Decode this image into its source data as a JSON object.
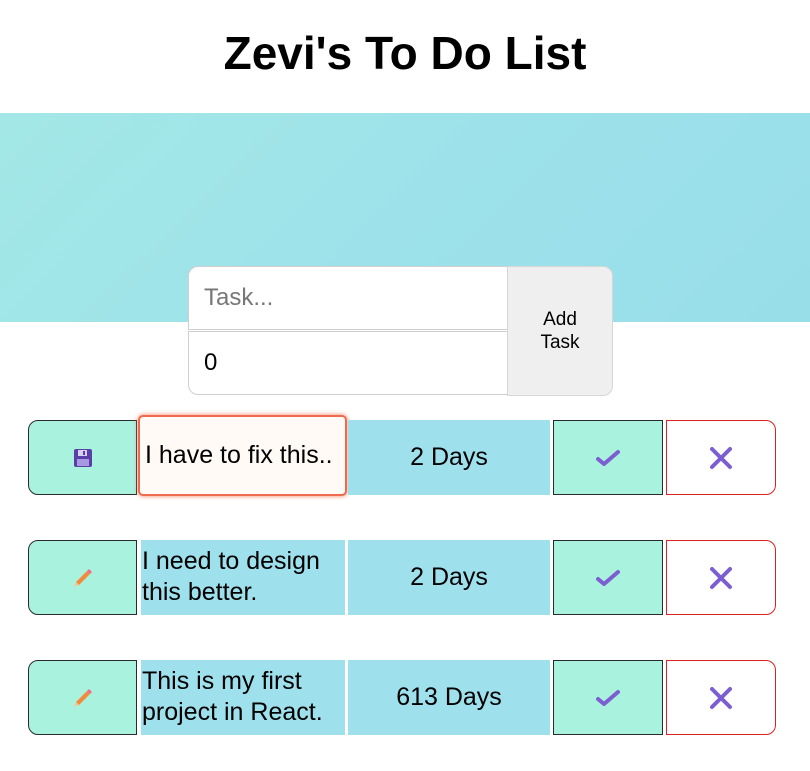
{
  "title": "Zevi's To Do List",
  "form": {
    "task_placeholder": "Task...",
    "task_value": "",
    "days_value": "0",
    "add_button_label": "Add Task"
  },
  "tasks": [
    {
      "text": "I have to fix this..",
      "days": "2 Days",
      "editing": true,
      "edit_icon": "floppy-disk-icon"
    },
    {
      "text": "I need to design this better.",
      "days": "2 Days",
      "editing": false,
      "edit_icon": "pencil-icon"
    },
    {
      "text": "This is my first project in React.",
      "days": "613 Days",
      "editing": false,
      "edit_icon": "pencil-icon"
    }
  ],
  "colors": {
    "band": "#9ee2ea",
    "button_mint": "#a8f2de",
    "cell_blue": "#9ee0ec",
    "delete_border": "#e02020",
    "edit_focus": "#ef6b50",
    "icon_purple": "#7b5fd0",
    "pencil_orange": "#f28a3c"
  }
}
